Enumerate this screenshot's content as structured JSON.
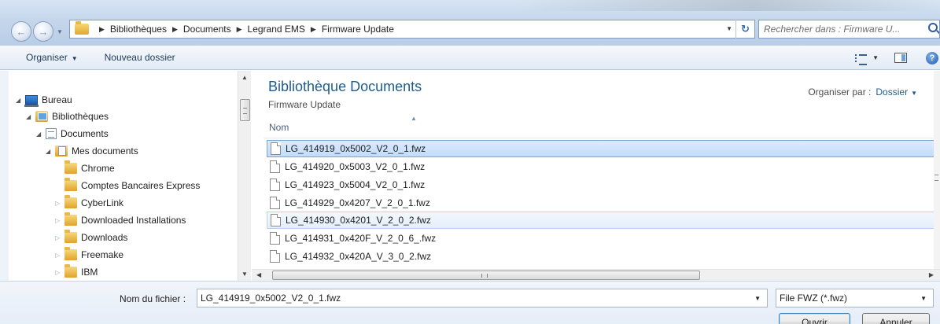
{
  "address": {
    "breadcrumbs": [
      "Bibliothèques",
      "Documents",
      "Legrand EMS",
      "Firmware Update"
    ],
    "search_placeholder": "Rechercher dans : Firmware U..."
  },
  "toolbar": {
    "organise_label": "Organiser",
    "new_folder_label": "Nouveau dossier"
  },
  "nav": {
    "items": [
      {
        "label": "Bureau",
        "icon": "desktop-icon",
        "expanded": true
      },
      {
        "label": "Bibliothèques",
        "icon": "libraries-icon",
        "expanded": true
      },
      {
        "label": "Documents",
        "icon": "documents-library-icon",
        "expanded": true
      },
      {
        "label": "Mes documents",
        "icon": "my-documents-icon",
        "expanded": true
      },
      {
        "label": "Chrome",
        "icon": "folder-icon"
      },
      {
        "label": "Comptes Bancaires Express",
        "icon": "folder-icon"
      },
      {
        "label": "CyberLink",
        "icon": "folder-icon",
        "expanded": false
      },
      {
        "label": "Downloaded Installations",
        "icon": "folder-icon",
        "expanded": false
      },
      {
        "label": "Downloads",
        "icon": "folder-icon",
        "expanded": false
      },
      {
        "label": "Freemake",
        "icon": "folder-icon",
        "expanded": false
      },
      {
        "label": "IBM",
        "icon": "folder-icon",
        "expanded": false
      }
    ]
  },
  "main": {
    "library_title": "Bibliothèque Documents",
    "library_subtitle": "Firmware Update",
    "arrange_label": "Organiser par :",
    "arrange_value": "Dossier",
    "column_name": "Nom",
    "files": [
      {
        "name": "LG_414919_0x5002_V2_0_1.fwz",
        "state": "selected"
      },
      {
        "name": "LG_414920_0x5003_V2_0_1.fwz",
        "state": ""
      },
      {
        "name": "LG_414923_0x5004_V2_0_1.fwz",
        "state": ""
      },
      {
        "name": "LG_414929_0x4207_V_2_0_1.fwz",
        "state": ""
      },
      {
        "name": "LG_414930_0x4201_V_2_0_2.fwz",
        "state": "hover"
      },
      {
        "name": "LG_414931_0x420F_V_2_0_6_.fwz",
        "state": ""
      },
      {
        "name": "LG_414932_0x420A_V_3_0_2.fwz",
        "state": ""
      }
    ]
  },
  "bottom": {
    "filename_label": "Nom du fichier :",
    "filename_value": "LG_414919_0x5002_V2_0_1.fwz",
    "filter_value": "File FWZ (*.fwz)",
    "open_label": "Ouvrir",
    "cancel_label": "Annuler"
  }
}
